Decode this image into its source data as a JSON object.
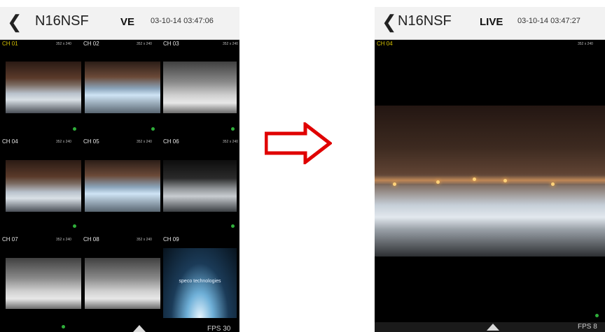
{
  "left_screen": {
    "device_name": "N16NSF",
    "mode": "VE",
    "timestamp": "03-10-14 03:47:06",
    "channels": [
      {
        "label": "CH 01",
        "resolution": "352 x 240",
        "selected": true
      },
      {
        "label": "CH 02",
        "resolution": "352 x 240"
      },
      {
        "label": "CH 03",
        "resolution": "352 x 240"
      },
      {
        "label": "CH 04",
        "resolution": "352 x 240"
      },
      {
        "label": "CH 05",
        "resolution": "352 x 240"
      },
      {
        "label": "CH 06",
        "resolution": "352 x 240"
      },
      {
        "label": "CH 07",
        "resolution": "352 x 240"
      },
      {
        "label": "CH 08",
        "resolution": "352 x 240"
      },
      {
        "label": "CH 09",
        "resolution": ""
      }
    ],
    "logo_text": "speco technologies",
    "fps_text": "FPS 30"
  },
  "right_screen": {
    "device_name": "N16NSF",
    "mode": "LIVE",
    "timestamp": "03-10-14 03:47:27",
    "channel_label": "CH 04",
    "resolution": "352 x 240",
    "fps_text": "FPS 8"
  },
  "colors": {
    "arrow": "#e00000",
    "status_dot": "#2fae3a",
    "selected_label": "#d6c200"
  },
  "icons": {
    "back": "chevron-left-icon",
    "transition": "right-arrow-icon",
    "expand": "caret-up-icon"
  }
}
